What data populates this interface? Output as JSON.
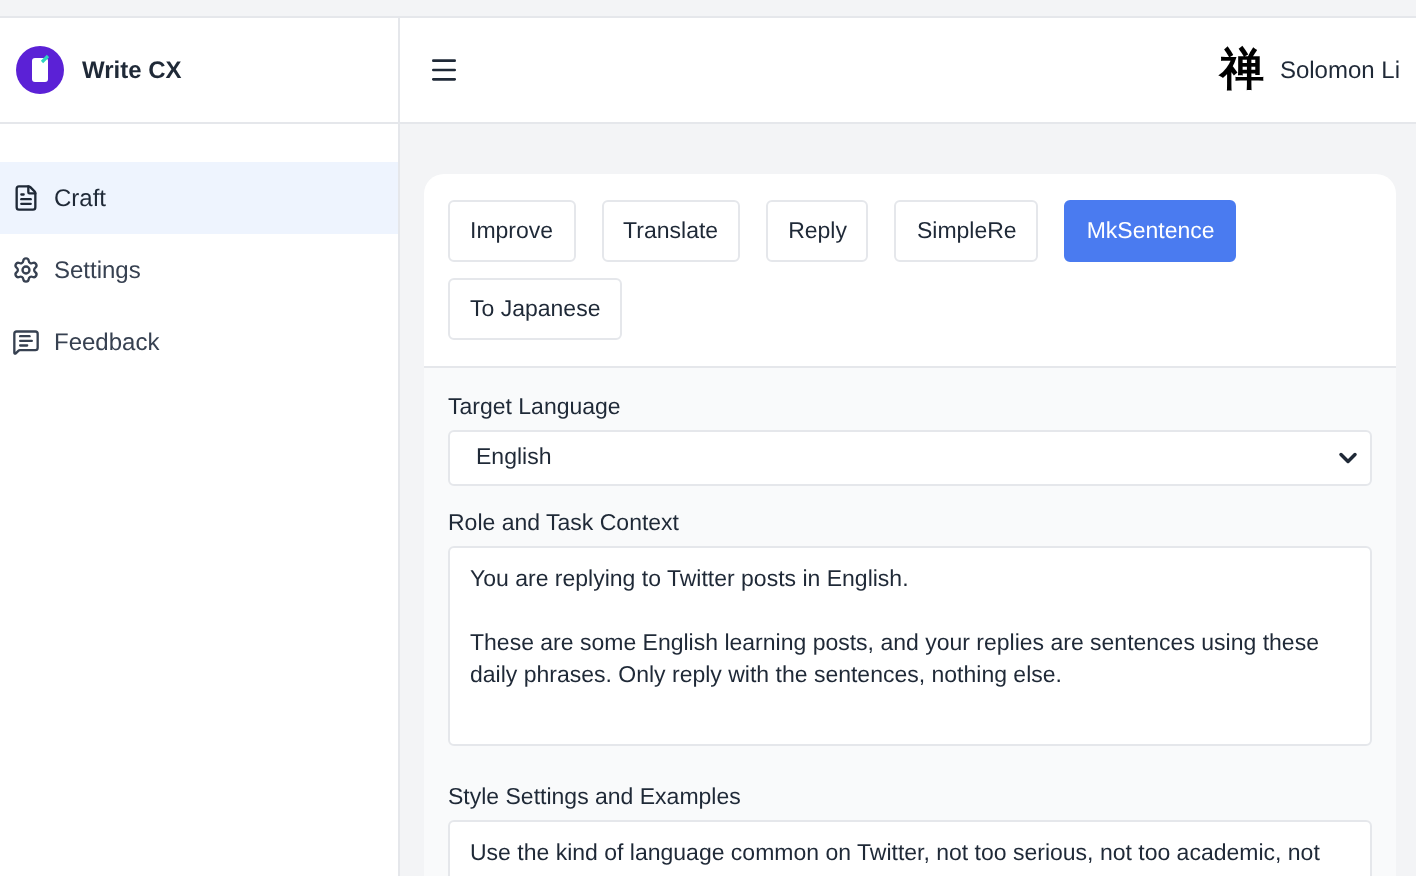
{
  "sidebar": {
    "app_name": "Write CX",
    "items": [
      {
        "label": "Craft",
        "selected": true
      },
      {
        "label": "Settings",
        "selected": false
      },
      {
        "label": "Feedback",
        "selected": false
      }
    ]
  },
  "header": {
    "avatar_glyph": "禅",
    "user_name": "Solomon Li"
  },
  "modes": [
    {
      "label": "Improve",
      "selected": false
    },
    {
      "label": "Translate",
      "selected": false
    },
    {
      "label": "Reply",
      "selected": false
    },
    {
      "label": "SimpleRe",
      "selected": false
    },
    {
      "label": "MkSentence",
      "selected": true
    },
    {
      "label": "To Japanese",
      "selected": false
    }
  ],
  "form": [
    {
      "kind": "select",
      "label": "Target Language",
      "value": "English"
    },
    {
      "kind": "textarea",
      "label": "Role and Task Context",
      "value": "You are replying to Twitter posts in English.\n\nThese are some English learning posts, and your replies are sentences using these daily phrases. Only reply with the sentences, nothing else."
    },
    {
      "kind": "textarea",
      "label": "Style Settings and Examples",
      "value": "Use the kind of language common on Twitter, not too serious, not too academic, not"
    }
  ]
}
